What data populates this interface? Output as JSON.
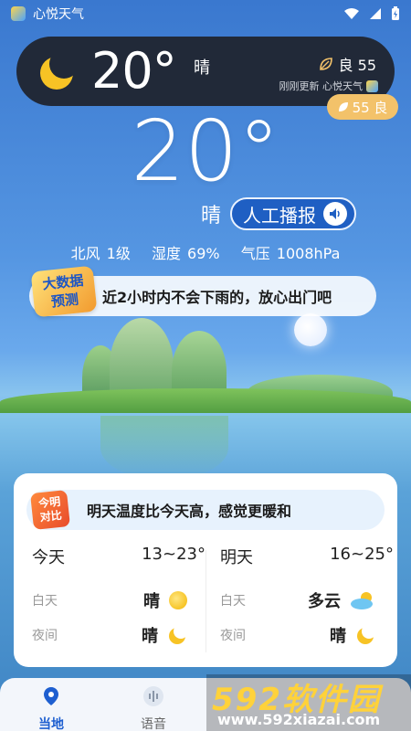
{
  "colors": {
    "accent": "#1e5fd0",
    "pill_bg": "#1e222a",
    "aqi_badge": "#f3c26a",
    "card_bg": "#ffffff"
  },
  "status_bar": {
    "app_name": "心悦天气",
    "icons": [
      "wifi-icon",
      "signal-icon",
      "battery-charging-icon"
    ]
  },
  "pill": {
    "icon": "crescent-moon-icon",
    "temp": "20°",
    "condition": "晴",
    "aqi_icon": "leaf-icon",
    "aqi_text": "良 55",
    "update_text": "刚刚更新 心悦天气"
  },
  "aqi_badge": {
    "text": "55 良"
  },
  "current": {
    "temp": "20°",
    "condition": "晴",
    "broadcast_label": "人工播报",
    "broadcast_icon": "speaker-icon",
    "wind": "北风 1级",
    "humidity": "湿度 69%",
    "pressure": "气压 1008hPa"
  },
  "forecast_banner": {
    "badge_line1": "大数据",
    "badge_line2": "预测",
    "text": "近2小时内不会下雨的，放心出门吧"
  },
  "compare_card": {
    "badge_line1": "今明",
    "badge_line2": "对比",
    "text": "明天温度比今天高，感觉更暖和",
    "today": {
      "label": "今天",
      "range": "13~23°",
      "day_label": "白天",
      "day_value": "晴",
      "day_icon": "sun-icon",
      "night_label": "夜间",
      "night_value": "晴",
      "night_icon": "moon-icon"
    },
    "tomorrow": {
      "label": "明天",
      "range": "16~25°",
      "day_label": "白天",
      "day_value": "多云",
      "day_icon": "cloud-sun-icon",
      "night_label": "夜间",
      "night_value": "晴",
      "night_icon": "moon-icon"
    }
  },
  "tabs": [
    {
      "label": "当地",
      "icon": "location-pin-icon",
      "active": true
    },
    {
      "label": "语音",
      "icon": "voice-wave-icon",
      "active": false
    }
  ],
  "watermark": {
    "big": "592软件园",
    "small": "www.592xiazai.com"
  }
}
